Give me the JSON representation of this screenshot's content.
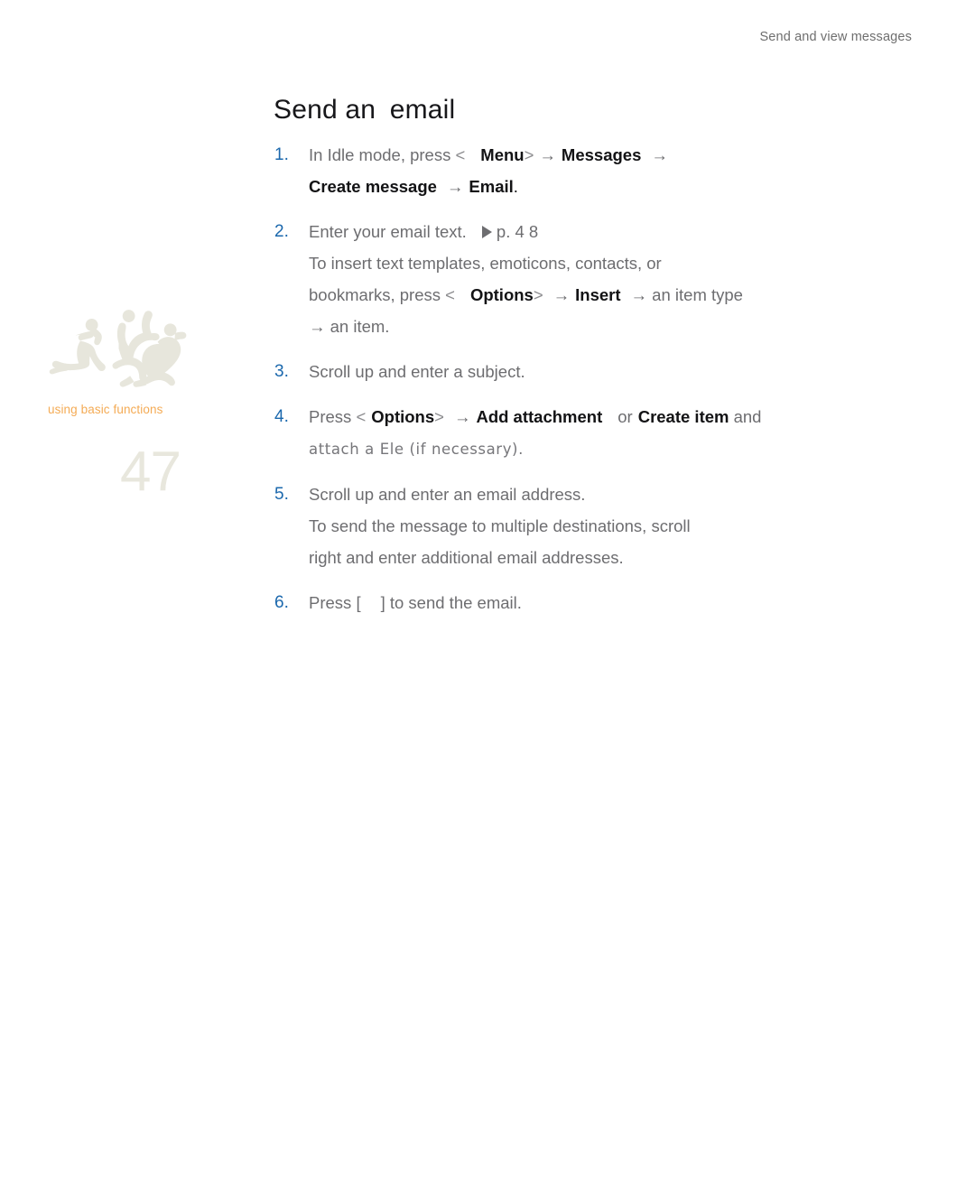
{
  "header": {
    "running_title": "Send and view messages"
  },
  "sidebar": {
    "graphic_name": "breakdancers-silhouette",
    "section_label": "using basic functions",
    "page_number": "47",
    "colors": {
      "graphic": "#e8e7dd",
      "section_label": "#f4ab55",
      "page_number": "#e8e7dd"
    }
  },
  "main": {
    "title_part1": "Send an",
    "title_part2": "email",
    "accent_number_color": "#1b68ad",
    "body_text_color": "#6d6d70",
    "emphasis_color": "#131315",
    "steps": [
      {
        "number": "1.",
        "lines": [
          {
            "runs": [
              {
                "t": "In Idle mode, press ",
                "s": "normal"
              },
              {
                "t": "<",
                "s": "bracket"
              },
              {
                "t": " ",
                "s": "gap-lg"
              },
              {
                "t": "Menu",
                "s": "bold"
              },
              {
                "t": ">",
                "s": "bracket"
              },
              {
                "t": " ",
                "s": "gap-sm"
              },
              {
                "t": "→",
                "s": "arrow"
              },
              {
                "t": " ",
                "s": "gap-sm"
              },
              {
                "t": "Messages",
                "s": "bold"
              },
              {
                "t": " ",
                "s": "gap-md"
              },
              {
                "t": "→",
                "s": "arrow"
              }
            ]
          },
          {
            "runs": [
              {
                "t": "Create message",
                "s": "bold"
              },
              {
                "t": " ",
                "s": "gap-md"
              },
              {
                "t": "→",
                "s": "arrow"
              },
              {
                "t": " ",
                "s": "gap-sm"
              },
              {
                "t": "Email",
                "s": "bold"
              },
              {
                "t": ".",
                "s": "dark"
              }
            ]
          }
        ]
      },
      {
        "number": "2.",
        "lines": [
          {
            "runs": [
              {
                "t": "Enter your email text.",
                "s": "normal"
              },
              {
                "t": " ",
                "s": "gap-lg"
              },
              {
                "t": "▶",
                "s": "triangle"
              },
              {
                "t": " p. 4 8",
                "s": "normal"
              }
            ]
          },
          {
            "runs": [
              {
                "t": "To insert text templates, emoticons, contacts, or",
                "s": "normal"
              }
            ]
          },
          {
            "runs": [
              {
                "t": "bookmarks, press ",
                "s": "normal"
              },
              {
                "t": "<",
                "s": "bracket"
              },
              {
                "t": " ",
                "s": "gap-lg"
              },
              {
                "t": "Options",
                "s": "bold"
              },
              {
                "t": ">",
                "s": "bracket"
              },
              {
                "t": " ",
                "s": "gap-md"
              },
              {
                "t": "→",
                "s": "arrow"
              },
              {
                "t": " ",
                "s": "gap-sm"
              },
              {
                "t": "Insert",
                "s": "bold"
              },
              {
                "t": " ",
                "s": "gap-md"
              },
              {
                "t": "→",
                "s": "arrow"
              },
              {
                "t": " an item type",
                "s": "normal"
              }
            ]
          },
          {
            "runs": [
              {
                "t": "→",
                "s": "arrow"
              },
              {
                "t": " an item.",
                "s": "normal"
              }
            ]
          }
        ]
      },
      {
        "number": "3.",
        "lines": [
          {
            "runs": [
              {
                "t": "Scroll up and enter a subject.",
                "s": "normal"
              }
            ]
          }
        ]
      },
      {
        "number": "4.",
        "lines": [
          {
            "runs": [
              {
                "t": "Press ",
                "s": "normal"
              },
              {
                "t": "<",
                "s": "bracket"
              },
              {
                "t": " ",
                "s": "gap-sm"
              },
              {
                "t": "Options",
                "s": "bold"
              },
              {
                "t": ">",
                "s": "bracket"
              },
              {
                "t": " ",
                "s": "gap-md"
              },
              {
                "t": "→",
                "s": "arrow"
              },
              {
                "t": " ",
                "s": "gap-sm"
              },
              {
                "t": "Add attachment",
                "s": "bold"
              },
              {
                "t": " ",
                "s": "gap-lg"
              },
              {
                "t": "or",
                "s": "normal"
              },
              {
                "t": " ",
                "s": "gap-sm"
              },
              {
                "t": "Create item",
                "s": "bold"
              },
              {
                "t": " and",
                "s": "normal"
              }
            ]
          },
          {
            "runs": [
              {
                "t": "attach a Ele (if necessary).",
                "s": "altfont"
              }
            ]
          }
        ]
      },
      {
        "number": "5.",
        "lines": [
          {
            "runs": [
              {
                "t": "Scroll up and enter an email address.",
                "s": "normal"
              }
            ]
          },
          {
            "runs": [
              {
                "t": "To send the message to multiple destinations, scroll",
                "s": "normal"
              }
            ]
          },
          {
            "runs": [
              {
                "t": "right and enter additional email addresses.",
                "s": "normal"
              }
            ]
          }
        ]
      },
      {
        "number": "6.",
        "lines": [
          {
            "runs": [
              {
                "t": "Press ",
                "s": "normal"
              },
              {
                "t": "[",
                "s": "normal"
              },
              {
                "t": "",
                "s": "keybox"
              },
              {
                "t": "]",
                "s": "normal"
              },
              {
                "t": " to send the email.",
                "s": "normal"
              }
            ]
          }
        ]
      }
    ]
  }
}
